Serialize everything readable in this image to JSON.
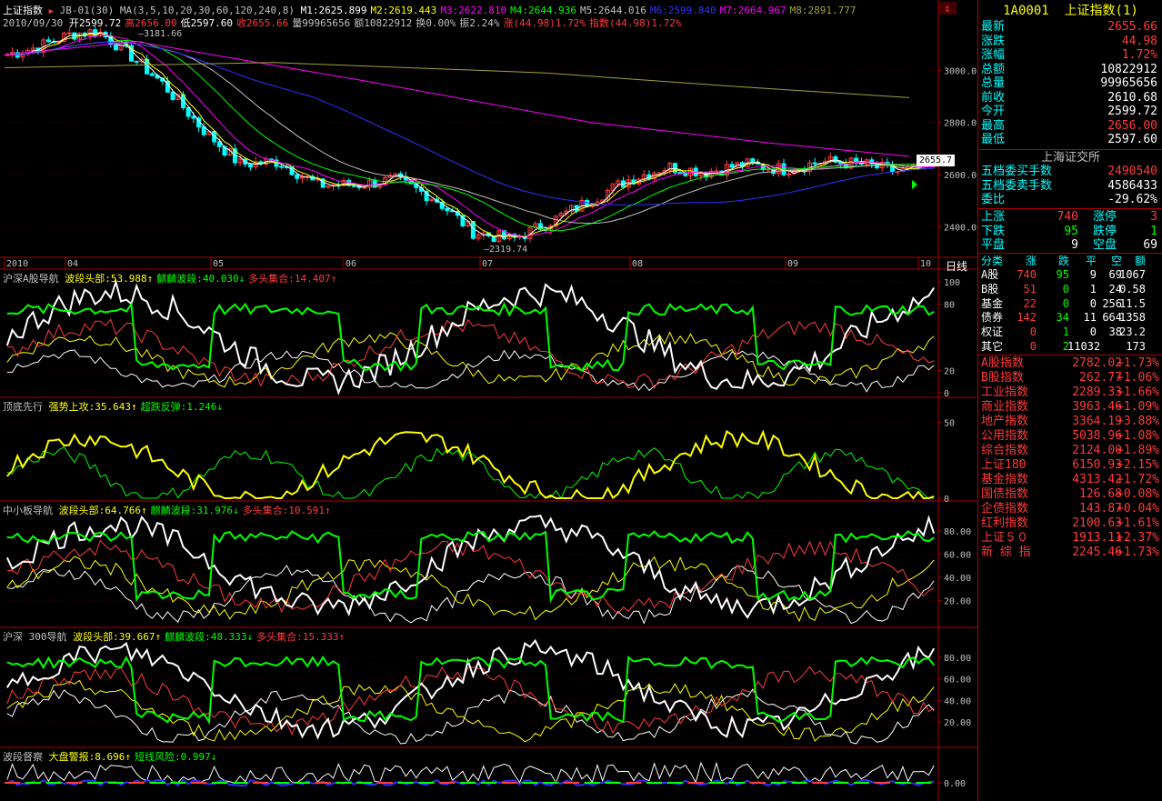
{
  "main": {
    "name": "上证指数",
    "indicator": "JB-01(30)",
    "ma_label": "MA(3,5,10,20,30,60,120,240,8)",
    "ma_values": [
      {
        "label": "M1:2625.899",
        "color": "#ffffff"
      },
      {
        "label": "M2:2619.443",
        "color": "#ffff00"
      },
      {
        "label": "M3:2622.810",
        "color": "#ff00ff"
      },
      {
        "label": "M4:2644.936",
        "color": "#00ff00"
      },
      {
        "label": "M5:2644.016",
        "color": "#c0c0c0"
      },
      {
        "label": "M6:2599.840",
        "color": "#3030ff"
      },
      {
        "label": "M7:2664.967",
        "color": "#ff00ff"
      },
      {
        "label": "M8:2891.777",
        "color": "#a0a040"
      }
    ],
    "date": "2010/09/30",
    "bar_info": [
      {
        "label": "开2599.72",
        "color": "#ffffff"
      },
      {
        "label": "高2656.00",
        "color": "#ff3b3b"
      },
      {
        "label": "低2597.60",
        "color": "#ffffff"
      },
      {
        "label": "收2655.66",
        "color": "#ff3b3b"
      },
      {
        "label": "量99965656",
        "color": "#c0c0c0"
      },
      {
        "label": "额10822912",
        "color": "#c0c0c0"
      },
      {
        "label": "换0.00%",
        "color": "#c0c0c0"
      },
      {
        "label": "振2.24%",
        "color": "#c0c0c0"
      },
      {
        "label": "涨(44.98)1.72%",
        "color": "#ff3b3b"
      },
      {
        "label": "指数(44.98)1.72%",
        "color": "#ff3b3b"
      }
    ],
    "high_label": "3181.66",
    "low_label": "2319.74",
    "price_tag": "2655.7",
    "y_ticks": [
      "3000.0",
      "2800.0",
      "2600.0",
      "2400.0"
    ],
    "y_range": [
      2300,
      3200
    ],
    "months": [
      "2010",
      "04",
      "05",
      "06",
      "07",
      "08",
      "09",
      "10"
    ],
    "period": "日线"
  },
  "panes": [
    {
      "title": "沪深A股导航",
      "items": [
        {
          "label": "波段头部:53.988",
          "color": "#ffff00"
        },
        {
          "label": "麒麟波段:40.030",
          "color": "#00ff00"
        },
        {
          "label": "多头集合:14.407",
          "color": "#ff3b3b"
        }
      ],
      "y_ticks": [
        "100",
        "80",
        "20",
        "0"
      ]
    },
    {
      "title": "顶底先行",
      "items": [
        {
          "label": "强势上攻:35.643",
          "color": "#ffff00"
        },
        {
          "label": "超跌反弹:1.246",
          "color": "#00ff00"
        }
      ],
      "y_ticks": [
        "50",
        "0"
      ]
    },
    {
      "title": "中小板导航",
      "items": [
        {
          "label": "波段头部:64.766",
          "color": "#ffff00"
        },
        {
          "label": "麒麟波段:31.976",
          "color": "#00ff00"
        },
        {
          "label": "多头集合:10.591",
          "color": "#ff3b3b"
        }
      ],
      "y_ticks": [
        "80.00",
        "60.00",
        "40.00",
        "20.00"
      ]
    },
    {
      "title": "沪深 300导航",
      "items": [
        {
          "label": "波段头部:39.667",
          "color": "#ffff00"
        },
        {
          "label": "麒麟波段:48.333",
          "color": "#00ff00"
        },
        {
          "label": "多头集合:15.333",
          "color": "#ff3b3b"
        }
      ],
      "y_ticks": [
        "80.00",
        "60.00",
        "40.00",
        "20.00"
      ]
    },
    {
      "title": "波段督察",
      "items": [
        {
          "label": "大盘警报:8.696",
          "color": "#ffff00"
        },
        {
          "label": "短线风险:0.997",
          "color": "#00ff00"
        }
      ],
      "y_ticks": [
        "0.00"
      ]
    }
  ],
  "side": {
    "code": "1A0001",
    "name": "上证指数(1)",
    "quote": [
      {
        "k": "最新",
        "v": "2655.66",
        "color": "#ff3b3b"
      },
      {
        "k": "涨跌",
        "v": "44.98",
        "color": "#ff3b3b"
      },
      {
        "k": "涨幅",
        "v": "1.72%",
        "color": "#ff3b3b"
      },
      {
        "k": "总额",
        "v": "10822912",
        "color": "#ffffff"
      },
      {
        "k": "总量",
        "v": "99965656",
        "color": "#ffffff"
      },
      {
        "k": "前收",
        "v": "2610.68",
        "color": "#ffffff"
      },
      {
        "k": "今开",
        "v": "2599.72",
        "color": "#ffffff"
      },
      {
        "k": "最高",
        "v": "2656.00",
        "color": "#ff3b3b"
      },
      {
        "k": "最低",
        "v": "2597.60",
        "color": "#ffffff"
      }
    ],
    "exchange": "上海证交所",
    "orders": [
      {
        "k": "五档委买手数",
        "v": "2490540",
        "color": "#ff3b3b"
      },
      {
        "k": "五档委卖手数",
        "v": "4586433",
        "color": "#ffffff"
      },
      {
        "k": "委比",
        "v": "-29.62%",
        "color": "#ffffff"
      }
    ],
    "breadth": [
      {
        "k1": "上涨",
        "v1": "740",
        "k2": "涨停",
        "v2": "3",
        "c": "#ff3b3b"
      },
      {
        "k1": "下跌",
        "v1": "95",
        "k2": "跌停",
        "v2": "1",
        "c": "#00ff00"
      },
      {
        "k1": "平盘",
        "v1": "9",
        "k2": "空盘",
        "v2": "69",
        "c": "#ffffff"
      }
    ],
    "cls_header": [
      "分类",
      "涨",
      "跌",
      "平",
      "空",
      "额"
    ],
    "cls_rows": [
      [
        "A股",
        "740",
        "95",
        "9",
        "69",
        "1067"
      ],
      [
        "B股",
        "51",
        "0",
        "1",
        "24",
        "0.58"
      ],
      [
        "基金",
        "22",
        "0",
        "0",
        "256",
        "11.5"
      ],
      [
        "债券",
        "142",
        "34",
        "11",
        "664",
        "1358"
      ],
      [
        "权证",
        "0",
        "1",
        "0",
        "38",
        "23.2"
      ],
      [
        "其它",
        "0",
        "2",
        "11032",
        "",
        "173"
      ]
    ],
    "indices": [
      {
        "n": "A股指数",
        "p": "2782.02",
        "c": "+1.73%"
      },
      {
        "n": "B股指数",
        "p": "262.77",
        "c": "+1.06%"
      },
      {
        "n": "工业指数",
        "p": "2289.33",
        "c": "+1.66%"
      },
      {
        "n": "商业指数",
        "p": "3963.46",
        "c": "+1.09%"
      },
      {
        "n": "地产指数",
        "p": "3364.19",
        "c": "+3.88%"
      },
      {
        "n": "公用指数",
        "p": "5038.96",
        "c": "+1.08%"
      },
      {
        "n": "综合指数",
        "p": "2124.00",
        "c": "+1.89%"
      },
      {
        "n": "上证180",
        "p": "6150.93",
        "c": "+2.15%"
      },
      {
        "n": "基金指数",
        "p": "4313.42",
        "c": "+1.72%"
      },
      {
        "n": "国债指数",
        "p": "126.68",
        "c": "+0.08%"
      },
      {
        "n": "企债指数",
        "p": "143.87",
        "c": "+0.04%"
      },
      {
        "n": "红利指数",
        "p": "2100.63",
        "c": "+1.61%"
      },
      {
        "n": "上证５０",
        "p": "1913.11",
        "c": "+2.37%"
      },
      {
        "n": "新 综 指",
        "p": "2245.46",
        "c": "+1.73%"
      }
    ]
  }
}
